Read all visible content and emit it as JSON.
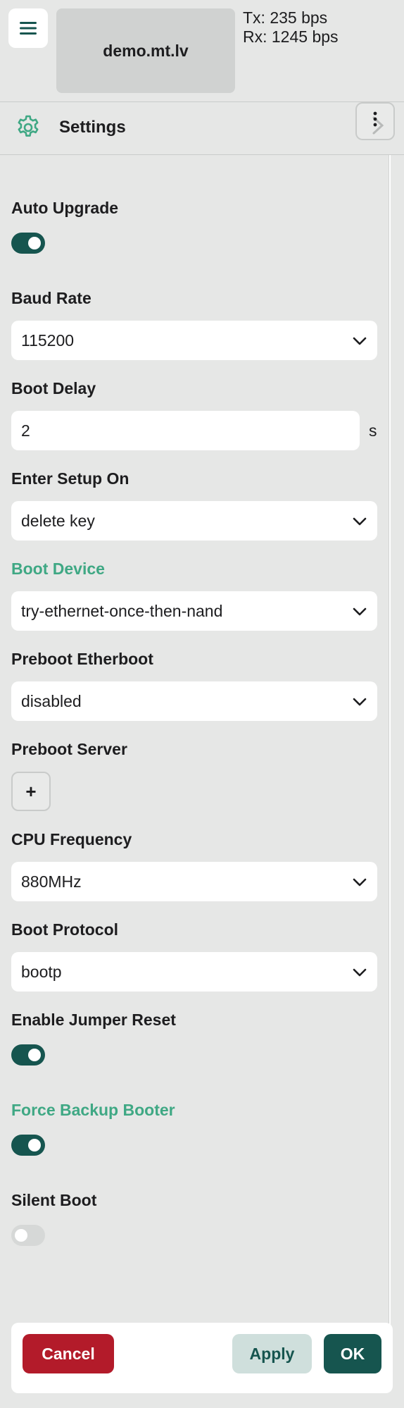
{
  "header": {
    "device_name": "demo.mt.lv",
    "tx": "Tx: 235 bps",
    "rx": "Rx: 1245 bps"
  },
  "settings": {
    "title": "Settings"
  },
  "fields": {
    "auto_upgrade": {
      "label": "Auto Upgrade",
      "value": true
    },
    "baud_rate": {
      "label": "Baud Rate",
      "value": "115200"
    },
    "boot_delay": {
      "label": "Boot Delay",
      "value": "2",
      "unit": "s"
    },
    "enter_setup_on": {
      "label": "Enter Setup On",
      "value": "delete key"
    },
    "boot_device": {
      "label": "Boot Device",
      "value": "try-ethernet-once-then-nand"
    },
    "preboot_etherboot": {
      "label": "Preboot Etherboot",
      "value": "disabled"
    },
    "preboot_server": {
      "label": "Preboot Server",
      "add_label": "+"
    },
    "cpu_frequency": {
      "label": "CPU Frequency",
      "value": "880MHz"
    },
    "boot_protocol": {
      "label": "Boot Protocol",
      "value": "bootp"
    },
    "enable_jumper_reset": {
      "label": "Enable Jumper Reset",
      "value": true
    },
    "force_backup_booter": {
      "label": "Force Backup Booter",
      "value": true
    },
    "silent_boot": {
      "label": "Silent Boot",
      "value": false
    }
  },
  "footer": {
    "cancel_label": "Cancel",
    "apply_label": "Apply",
    "ok_label": "OK"
  },
  "colors": {
    "accent_green": "#3fa884",
    "primary_dark": "#16554f",
    "danger": "#b31b2a",
    "background": "#e6e7e6"
  },
  "icons": {
    "menu": "hamburger-icon",
    "settings": "gear-icon",
    "more": "more-vertical-icon",
    "collapse": "chevron-right-icon",
    "dropdown": "chevron-down-icon"
  }
}
